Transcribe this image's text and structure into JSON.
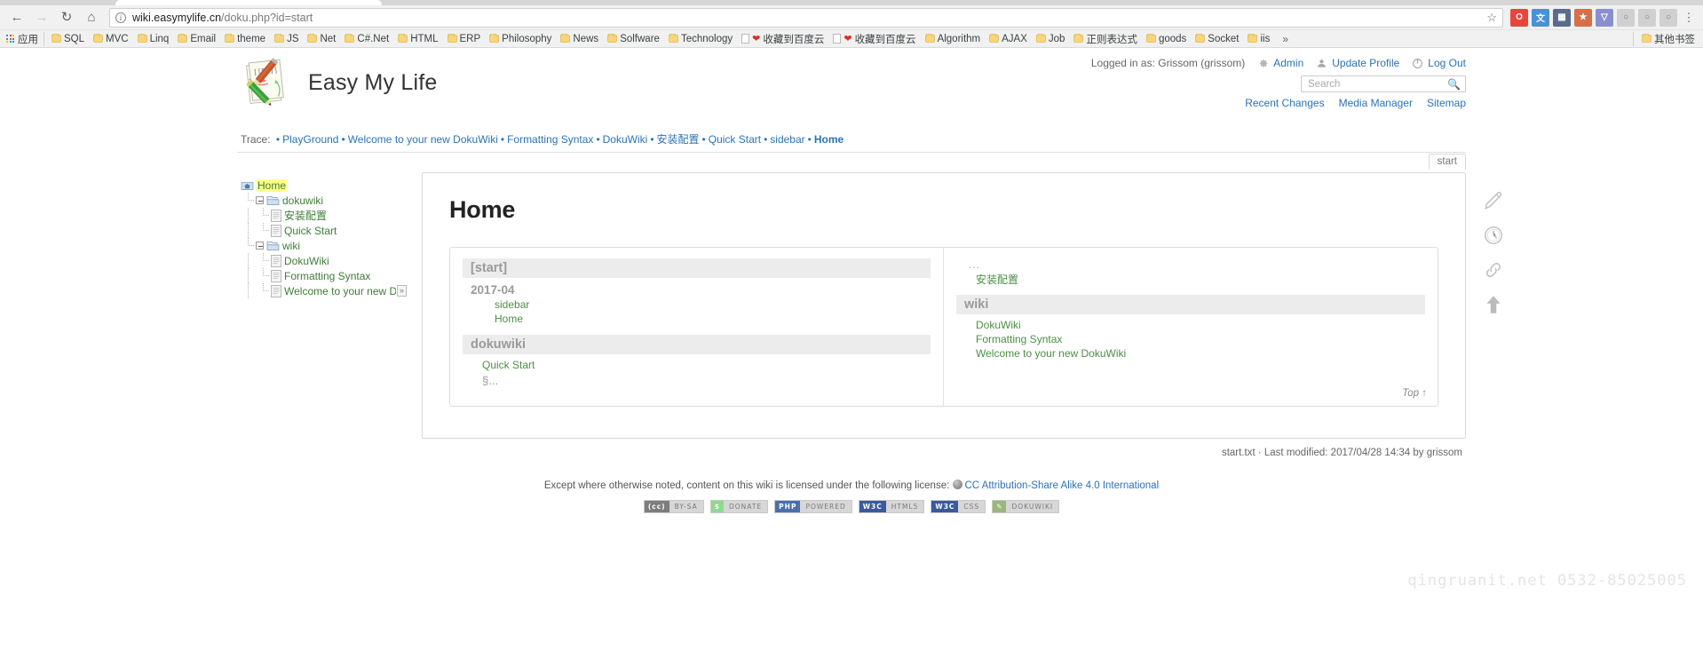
{
  "browser": {
    "back_icon": "back-arrow-icon",
    "forward_icon": "forward-arrow-icon",
    "reload_icon": "reload-icon",
    "home_icon": "home-icon",
    "url_host": "wiki.easymylife.cn",
    "url_path": "/doku.php?id=start",
    "star_icon": "bookmark-star-icon",
    "menu_icon": "kebab-menu-icon",
    "extensions": [
      {
        "name": "opera-extension-icon",
        "glyph": "O",
        "color": "#e8453c"
      },
      {
        "name": "translate-extension-icon",
        "glyph": "文",
        "color": "#4a90d9"
      },
      {
        "name": "grid-extension-icon",
        "glyph": "▦",
        "color": "#5b6b8c"
      },
      {
        "name": "bookmark-extension-icon",
        "glyph": "★",
        "color": "#d4704a"
      },
      {
        "name": "funnel-extension-icon",
        "glyph": "▽",
        "color": "#8a8fd0"
      },
      {
        "name": "circle-extension-icon",
        "glyph": "○",
        "color": "#b8b8b8"
      },
      {
        "name": "circle2-extension-icon",
        "glyph": "○",
        "color": "#b8b8b8"
      },
      {
        "name": "circle3-extension-icon",
        "glyph": "○",
        "color": "#b8b8b8"
      }
    ]
  },
  "bookmarks": {
    "apps_label": "应用",
    "overflow_label": "»",
    "other_label": "其他书签",
    "items": [
      {
        "label": "SQL",
        "type": "folder"
      },
      {
        "label": "MVC",
        "type": "folder"
      },
      {
        "label": "Linq",
        "type": "folder"
      },
      {
        "label": "Email",
        "type": "folder"
      },
      {
        "label": "theme",
        "type": "folder"
      },
      {
        "label": "JS",
        "type": "folder"
      },
      {
        "label": "Net",
        "type": "folder"
      },
      {
        "label": "C#.Net",
        "type": "folder"
      },
      {
        "label": "HTML",
        "type": "folder"
      },
      {
        "label": "ERP",
        "type": "folder"
      },
      {
        "label": "Philosophy",
        "type": "folder"
      },
      {
        "label": "News",
        "type": "folder"
      },
      {
        "label": "Solfware",
        "type": "folder"
      },
      {
        "label": "Technology",
        "type": "folder"
      },
      {
        "label": "收藏到百度云",
        "type": "page-heart"
      },
      {
        "label": "收藏到百度云",
        "type": "page-heart"
      },
      {
        "label": "Algorithm",
        "type": "folder"
      },
      {
        "label": "AJAX",
        "type": "folder"
      },
      {
        "label": "Job",
        "type": "folder"
      },
      {
        "label": "正则表达式",
        "type": "folder"
      },
      {
        "label": "goods",
        "type": "folder"
      },
      {
        "label": "Socket",
        "type": "folder"
      },
      {
        "label": "iis",
        "type": "folder"
      }
    ]
  },
  "wiki": {
    "site_title": "Easy My Life",
    "logo_icon": "dokuwiki-logo-icon",
    "user_status": "Logged in as: Grissom (grissom)",
    "user_tools": [
      {
        "label": "Admin",
        "icon": "gear-icon"
      },
      {
        "label": "Update Profile",
        "icon": "user-icon"
      },
      {
        "label": "Log Out",
        "icon": "power-icon"
      }
    ],
    "search": {
      "placeholder": "Search",
      "value": "",
      "icon": "search-icon"
    },
    "site_tools": [
      {
        "label": "Recent Changes"
      },
      {
        "label": "Media Manager"
      },
      {
        "label": "Sitemap"
      }
    ],
    "trace": {
      "label": "Trace:",
      "items": [
        "PlayGround",
        "Welcome to your new DokuWiki",
        "Formatting Syntax",
        "DokuWiki",
        "安装配置",
        "Quick Start",
        "sidebar"
      ],
      "current": "Home"
    },
    "sidebar_tree": [
      {
        "label": "Home",
        "level": 0,
        "type": "home",
        "highlight": true,
        "expander": false
      },
      {
        "label": "dokuwiki",
        "level": 1,
        "type": "folder",
        "expander": true
      },
      {
        "label": "安装配置",
        "level": 2,
        "type": "page",
        "expander": false
      },
      {
        "label": "Quick Start",
        "level": 2,
        "type": "page",
        "expander": false
      },
      {
        "label": "wiki",
        "level": 1,
        "type": "folder",
        "expander": true
      },
      {
        "label": "DokuWiki",
        "level": 2,
        "type": "page",
        "expander": false
      },
      {
        "label": "Formatting Syntax",
        "level": 2,
        "type": "page",
        "expander": false
      },
      {
        "label": "Welcome to your new DokuWiki",
        "level": 2,
        "type": "page",
        "expander": false,
        "truncated": true,
        "overflow": "»"
      }
    ],
    "page_tab": "start",
    "page_title": "Home",
    "index_left": {
      "heading": "[start]",
      "subheading": "2017-04",
      "links": [
        "sidebar",
        "Home"
      ],
      "heading2": "dokuwiki",
      "links2": [
        "Quick Start"
      ],
      "section_marker": "§..."
    },
    "index_right": {
      "dots": "...",
      "link_top": "安装配置",
      "heading": "wiki",
      "links": [
        "DokuWiki",
        "Formatting Syntax",
        "Welcome to your new DokuWiki"
      ],
      "top_label": "Top ↑"
    },
    "page_tools": [
      {
        "name": "edit-page-icon",
        "label": "Edit this page"
      },
      {
        "name": "old-revisions-icon",
        "label": "Old revisions"
      },
      {
        "name": "backlinks-icon",
        "label": "Backlinks"
      },
      {
        "name": "back-to-top-icon",
        "label": "Back to top"
      }
    ],
    "docinfo": "start.txt · Last modified: 2017/04/28 14:34 by grissom",
    "license_text": "Except where otherwise noted, content on this wiki is licensed under the following license:",
    "license_link": "CC Attribution-Share Alike 4.0 International",
    "badges": [
      {
        "left": "(cc)",
        "right": "BY-SA",
        "left_bg": "#7d7d7d",
        "right_bg": "#d7d7d7"
      },
      {
        "left": "$",
        "right": "DONATE",
        "left_bg": "#8ddb8d",
        "right_bg": "#d7d7d7"
      },
      {
        "left": "PHP",
        "right": "POWERED",
        "left_bg": "#4a6fae",
        "right_bg": "#d7d7d7"
      },
      {
        "left": "W3C",
        "right": "HTML5",
        "left_bg": "#3b5a9e",
        "right_bg": "#d7d7d7"
      },
      {
        "left": "W3C",
        "right": "CSS",
        "left_bg": "#3b5a9e",
        "right_bg": "#d7d7d7"
      },
      {
        "left": "✎",
        "right": "DOKUWIKI",
        "left_bg": "#9ab87d",
        "right_bg": "#d7d7d7"
      }
    ],
    "watermark": "qingruanit.net  0532-85025005"
  }
}
